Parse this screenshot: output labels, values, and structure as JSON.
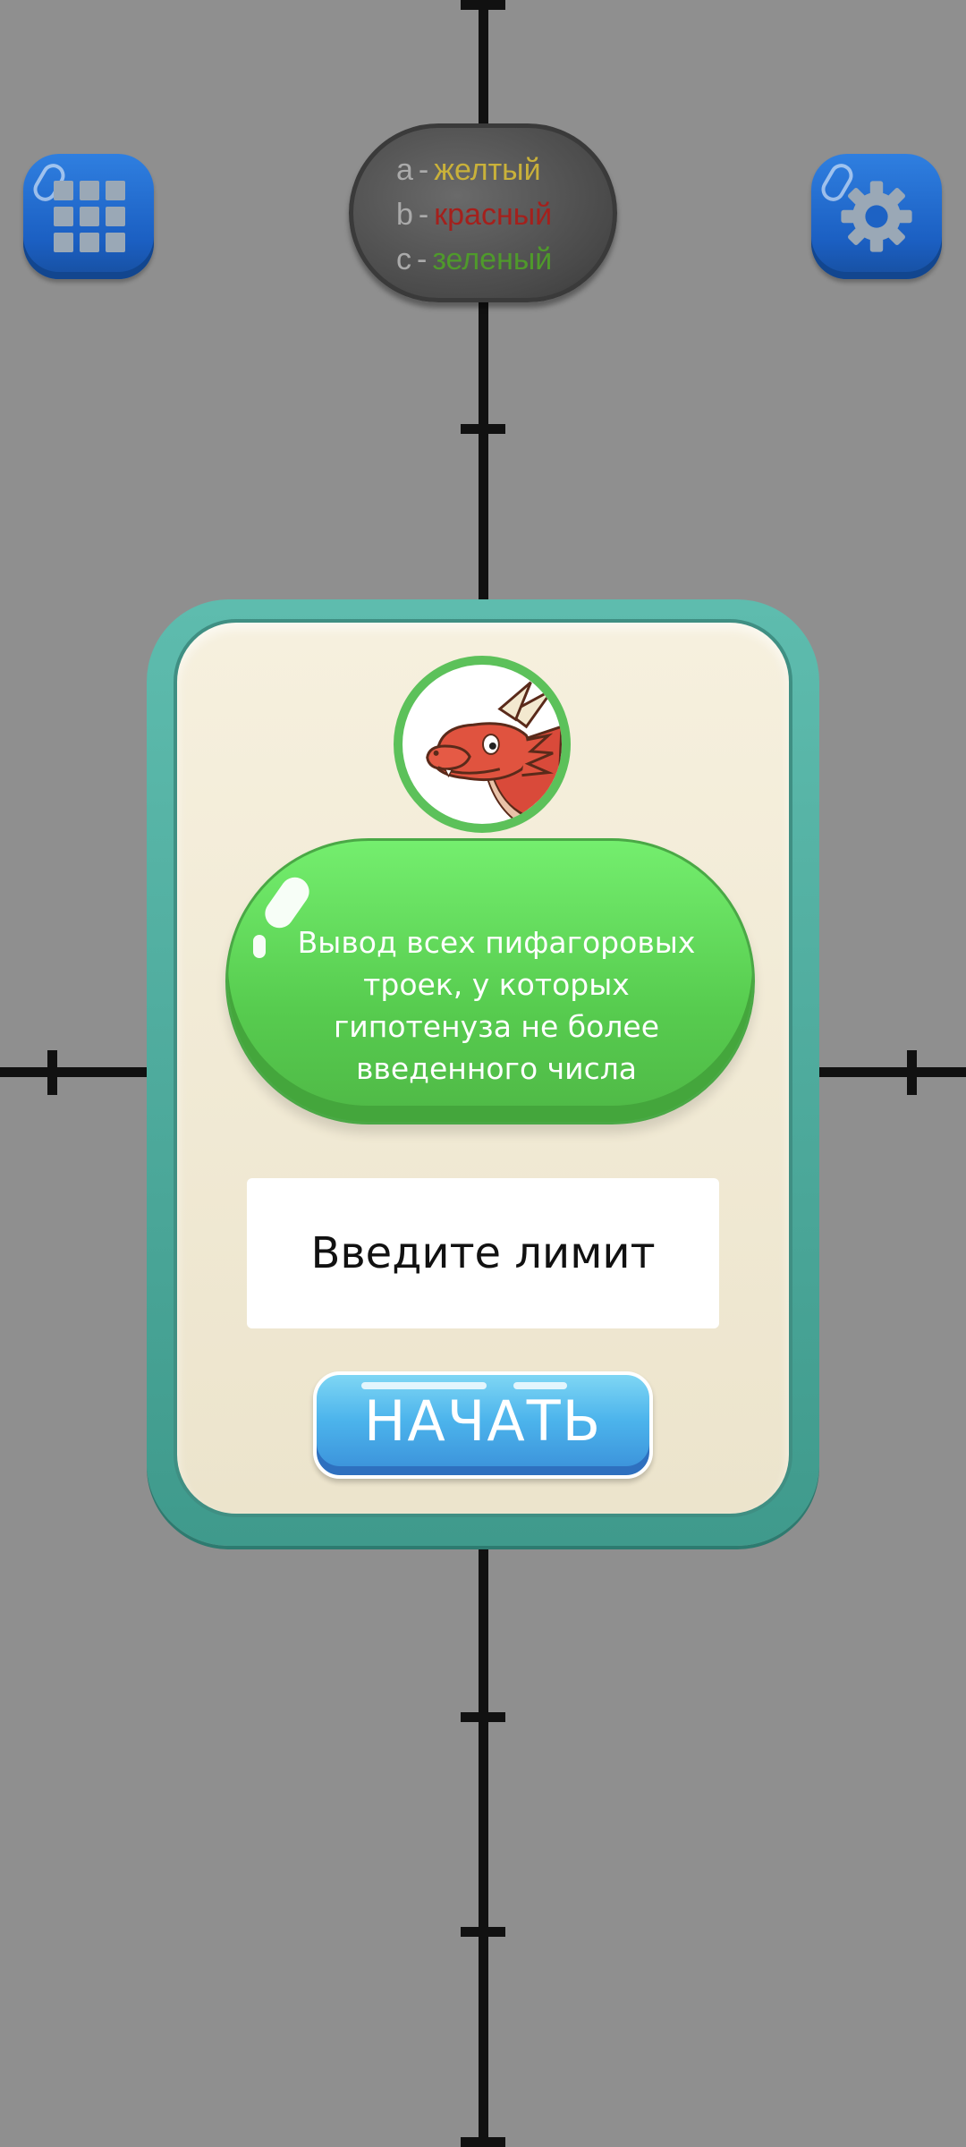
{
  "legend": {
    "rows": [
      {
        "var": "a",
        "sep": "-",
        "color_name": "желтый",
        "color": "#c9b13a"
      },
      {
        "var": "b",
        "sep": "-",
        "color_name": "красный",
        "color": "#a4201c"
      },
      {
        "var": "c",
        "sep": "-",
        "color_name": "зеленый",
        "color": "#4f9a2b"
      }
    ]
  },
  "toolbar": {
    "menu_icon": "grid-icon",
    "settings_icon": "gear-icon"
  },
  "dialog": {
    "avatar_icon": "red-dragon-icon",
    "title": "Вывод всех пифагоровых троек, у которых гипотенуза не более введенного числа",
    "input_placeholder": "Введите лимит",
    "input_value": "",
    "start_label": "НАЧАТЬ"
  }
}
